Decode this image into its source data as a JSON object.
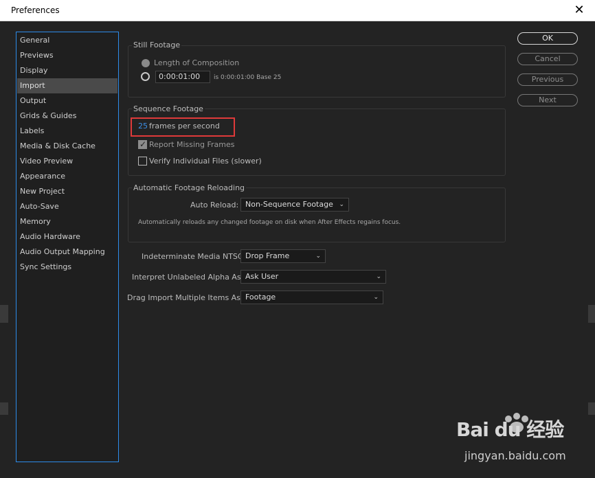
{
  "window": {
    "title": "Preferences",
    "close_symbol": "✕"
  },
  "sidebar": {
    "items": [
      {
        "label": "General"
      },
      {
        "label": "Previews"
      },
      {
        "label": "Display"
      },
      {
        "label": "Import"
      },
      {
        "label": "Output"
      },
      {
        "label": "Grids & Guides"
      },
      {
        "label": "Labels"
      },
      {
        "label": "Media & Disk Cache"
      },
      {
        "label": "Video Preview"
      },
      {
        "label": "Appearance"
      },
      {
        "label": "New Project"
      },
      {
        "label": "Auto-Save"
      },
      {
        "label": "Memory"
      },
      {
        "label": "Audio Hardware"
      },
      {
        "label": "Audio Output Mapping"
      },
      {
        "label": "Sync Settings"
      }
    ],
    "selected_index": 3
  },
  "still_footage": {
    "title": "Still Footage",
    "length_label": "Length of Composition",
    "duration_value": "0:00:01:00",
    "duration_info": "is 0:00:01:00  Base 25"
  },
  "sequence_footage": {
    "title": "Sequence Footage",
    "fps_value": "25",
    "fps_label": "frames per second",
    "report_missing_label": "Report Missing Frames",
    "report_missing_checked": true,
    "verify_label": "Verify Individual Files (slower)",
    "verify_checked": false
  },
  "auto_reload": {
    "title": "Automatic Footage Reloading",
    "label": "Auto Reload:",
    "value": "Non-Sequence Footage",
    "description": "Automatically reloads any changed footage on disk when After Effects regains focus."
  },
  "settings": {
    "ntsc_label": "Indeterminate Media NTSC:",
    "ntsc_value": "Drop Frame",
    "alpha_label": "Interpret Unlabeled Alpha As:",
    "alpha_value": "Ask User",
    "drag_label": "Drag Import Multiple Items As:",
    "drag_value": "Footage"
  },
  "buttons": {
    "ok": "OK",
    "cancel": "Cancel",
    "previous": "Previous",
    "next": "Next"
  },
  "watermark": {
    "brand": "Bai du 经验",
    "url": "jingyan.baidu.com"
  },
  "colors": {
    "accent_blue": "#2d8ceb",
    "highlight_red": "#e03a3a",
    "link_blue": "#3d90e8"
  }
}
